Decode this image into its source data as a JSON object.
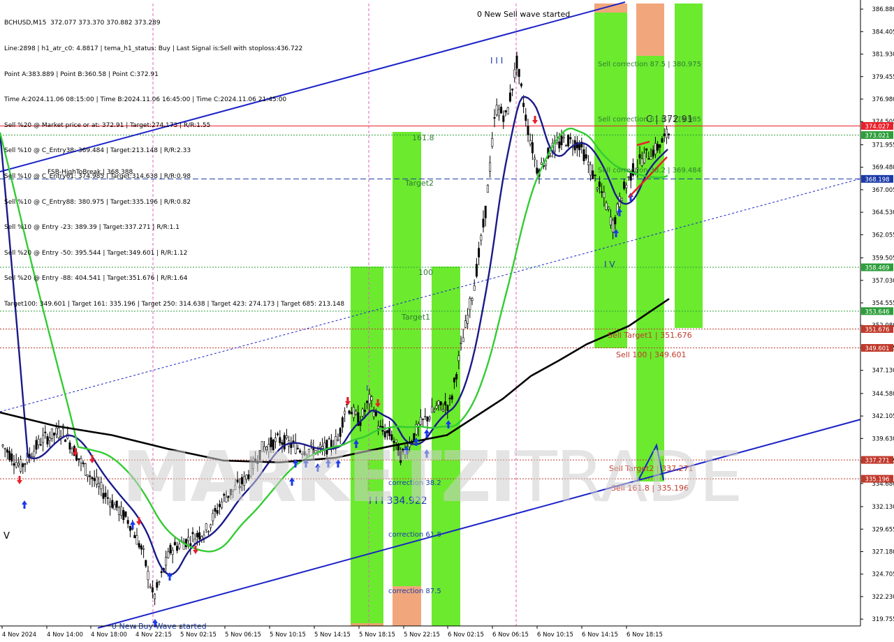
{
  "symbol_header": "BCHUSD,M15  372.077 373.370 370.882 373.289",
  "info_lines": [
    "Line:2898 | h1_atr_c0: 4.8817 | tema_h1_status: Buy | Last Signal is:Sell with stoploss:436.722",
    "Point A:383.889 | Point B:360.58 | Point C:372.91",
    "Time A:2024.11.06 08:15:00 | Time B:2024.11.06 16:45:00 | Time C:2024.11.06 21:45:00",
    "Sell %20 @ Market price or at: 372.91 | Target:274.173 | R/R:1.55",
    "Sell %10 @ C_Entry38: 369.484 | Target:213.148 | R/R:2.33",
    "Sell %10 @ C_Entry61: 374.985 | Target:314.638 | R/R:0.98",
    "Sell %10 @ C_Entry88: 380.975 | Target:335.196 | R/R:0.82",
    "Sell %10 @ Entry -23: 389.39 | Target:337.271 | R/R:1.1",
    "Sell %20 @ Entry -50: 395.544 | Target:349.601 | R/R:1.12",
    "Sell %20 @ Entry -88: 404.541 | Target:351.676 | R/R:1.64",
    "Target100: 349.601 | Target 161: 335.196 | Target 250: 314.638 | Target 423: 274.173 | Target 685: 213.148"
  ],
  "watermark": {
    "bold": "MARKETZI",
    "thin": "TRADE"
  },
  "chart_data": {
    "type": "candlestick",
    "ylim": [
      319.0,
      387.5
    ],
    "y_ticks": [
      386.88,
      384.405,
      381.93,
      379.455,
      376.98,
      374.505,
      371.955,
      369.48,
      367.005,
      364.53,
      362.055,
      359.505,
      357.03,
      354.555,
      352.08,
      349.605,
      347.13,
      344.58,
      342.105,
      339.63,
      337.155,
      334.68,
      332.13,
      329.655,
      327.18,
      324.705,
      322.23,
      319.755
    ],
    "x_labels": [
      "4 Nov 2024",
      "4 Nov 14:00",
      "4 Nov 18:00",
      "4 Nov 22:15",
      "5 Nov 02:15",
      "5 Nov 06:15",
      "5 Nov 10:15",
      "5 Nov 14:15",
      "5 Nov 18:15",
      "5 Nov 22:15",
      "6 Nov 02:15",
      "6 Nov 06:15",
      "6 Nov 10:15",
      "6 Nov 14:15",
      "6 Nov 18:15"
    ],
    "price_tags": [
      {
        "value": 374.027,
        "label": "374.027",
        "color": "#e8202a"
      },
      {
        "value": 373.021,
        "label": "373.021",
        "color": "#2e9e3b"
      },
      {
        "value": 368.198,
        "label": "368.198",
        "color": "#1a3aa8"
      },
      {
        "value": 358.469,
        "label": "358.469",
        "color": "#2e9e3b"
      },
      {
        "value": 353.646,
        "label": "353.646",
        "color": "#2e9e3b"
      },
      {
        "value": 351.676,
        "label": "351.676",
        "color": "#c0392b"
      },
      {
        "value": 349.601,
        "label": "349.601",
        "color": "#c0392b"
      },
      {
        "value": 337.271,
        "label": "337.271",
        "color": "#c0392b"
      },
      {
        "value": 335.196,
        "label": "335.196",
        "color": "#c0392b"
      }
    ],
    "horizontal_levels": [
      {
        "value": 374.027,
        "color": "#e8202a",
        "style": "solid"
      },
      {
        "value": 373.021,
        "color": "#2e9e3b",
        "style": "dotted"
      },
      {
        "value": 368.198,
        "color": "#1a3aa8",
        "style": "dashed"
      },
      {
        "value": 358.469,
        "color": "#2e9e3b",
        "style": "dotted"
      },
      {
        "value": 353.646,
        "color": "#2e9e3b",
        "style": "dotted"
      },
      {
        "value": 351.676,
        "color": "#c0392b",
        "style": "dotted"
      },
      {
        "value": 349.601,
        "color": "#c0392b",
        "style": "dotted"
      },
      {
        "value": 337.271,
        "color": "#c0392b",
        "style": "dotted"
      },
      {
        "value": 335.196,
        "color": "#c0392b",
        "style": "dotted"
      }
    ],
    "annotations": [
      {
        "text": "0 New Sell wave started",
        "color": "#000000"
      },
      {
        "text": "0 New Buy Wave started",
        "color": "#1a3aa8"
      },
      {
        "text": "FSB-HighToBreak | 368.388",
        "color": "#000000"
      },
      {
        "text": "I I I",
        "color": "#1a3aa8"
      },
      {
        "text": "I V",
        "color": "#1a3aa8"
      },
      {
        "text": "V",
        "color": "#000000"
      },
      {
        "text": "I",
        "color": "#1a3aa8"
      },
      {
        "text": "I I I 334.922",
        "color": "#1a3aa8"
      },
      {
        "text": "161.8",
        "color": "#2e7d32"
      },
      {
        "text": "Target2",
        "color": "#2e7d32"
      },
      {
        "text": "100",
        "color": "#2e7d32"
      },
      {
        "text": "Target1",
        "color": "#2e7d32"
      },
      {
        "text": "correction 38.2",
        "color": "#1a3aa8"
      },
      {
        "text": "correction 61.8",
        "color": "#1a3aa8"
      },
      {
        "text": "correction 87.5",
        "color": "#1a3aa8"
      },
      {
        "text": "Sell correction 87.5 | 380.975",
        "color": "#2e7d32"
      },
      {
        "text": "Sell correction 61.8 | 374.985",
        "color": "#2e7d32"
      },
      {
        "text": "C | 372.91",
        "color": "#333333"
      },
      {
        "text": "Sell correction 38.2 | 369.484",
        "color": "#2e7d32"
      },
      {
        "text": "Sell Target1 | 351.676",
        "color": "#c0392b"
      },
      {
        "text": "Sell 100 | 349.601",
        "color": "#c0392b"
      },
      {
        "text": "Sell Target2 | 337.271",
        "color": "#c0392b"
      },
      {
        "text": "Sell 161.8 | 335.196",
        "color": "#c0392b"
      }
    ]
  }
}
